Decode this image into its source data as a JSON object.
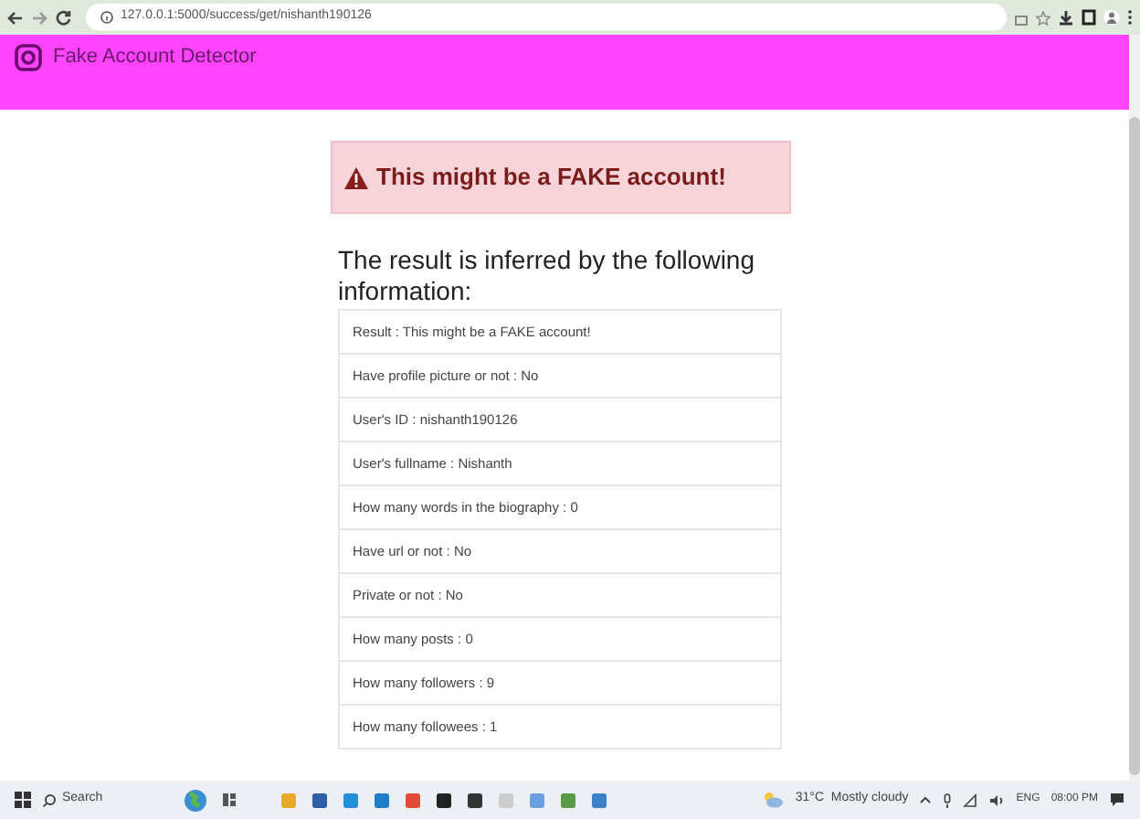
{
  "browser": {
    "url": "127.0.0.1:5000/success/get/nishanth190126"
  },
  "navbar": {
    "title": "Fake Account Detector"
  },
  "alert": {
    "text": "This might be a FAKE account!"
  },
  "heading": "The result is inferred by the following information:",
  "details": [
    {
      "text": "Result : This might be a FAKE account!"
    },
    {
      "text": "Have profile picture or not : No"
    },
    {
      "text": "User's ID : nishanth190126"
    },
    {
      "text": "User's fullname : Nishanth"
    },
    {
      "text": "How many words in the biography : 0"
    },
    {
      "text": "Have url or not : No"
    },
    {
      "text": "Private or not : No"
    },
    {
      "text": "How many posts : 0"
    },
    {
      "text": "How many followers : 9"
    },
    {
      "text": "How many followees : 1"
    }
  ],
  "taskbar": {
    "search": "Search",
    "weather": "31°C  Mostly cloudy",
    "language": "ENG",
    "time": "08:00 PM"
  }
}
